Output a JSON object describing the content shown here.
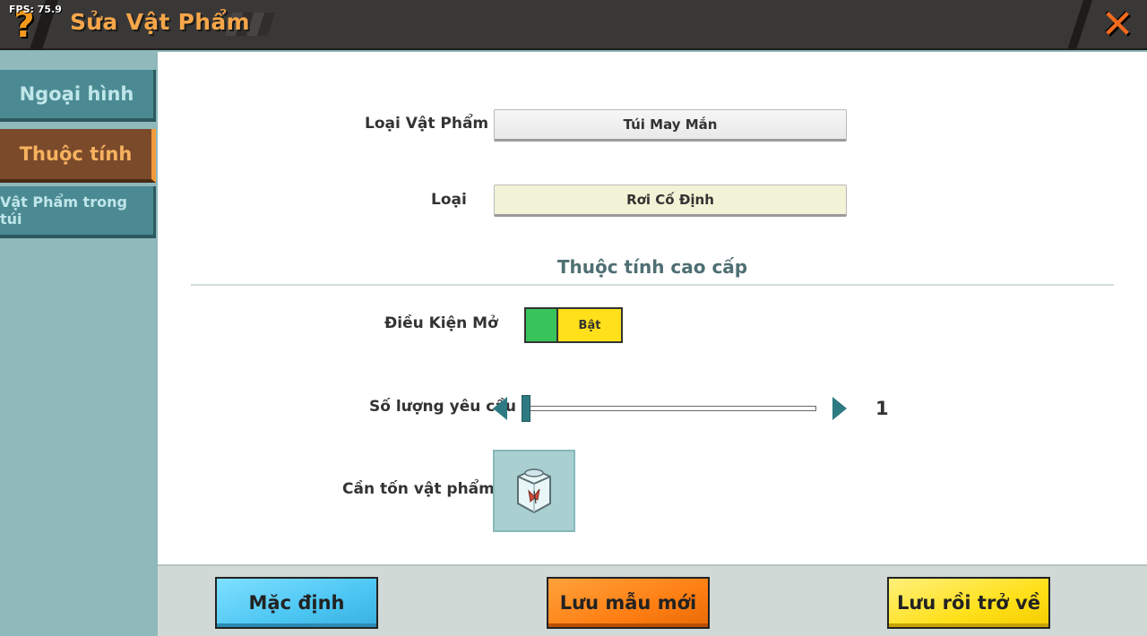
{
  "header": {
    "title": "Sửa Vật Phẩm",
    "fps": "FPS: 75.9",
    "help_icon": "question-mark-icon",
    "close_icon": "close-x-icon"
  },
  "sidebar": {
    "items": [
      {
        "label": "Ngoại hình",
        "active": false
      },
      {
        "label": "Thuộc tính",
        "active": true
      },
      {
        "label": "Vật Phẩm trong túi",
        "active": false
      }
    ]
  },
  "form": {
    "item_type_label": "Loại Vật Phẩm",
    "item_type_value": "Túi May Mắn",
    "type_label": "Loại",
    "type_value": "Rơi Cố Định",
    "section_title": "Thuộc tính cao cấp",
    "unlock_condition_label": "Điều Kiện Mở",
    "unlock_toggle_label": "Bật",
    "quantity_label": "Số lượng yêu cầu",
    "quantity_value": "1",
    "required_item_label": "Cần tốn vật phẩm",
    "required_item_icon": "glass-jar-butterfly-icon"
  },
  "footer": {
    "default_label": "Mặc định",
    "save_template_label": "Lưu mẫu mới",
    "save_return_label": "Lưu rồi trở về",
    "debug_left": "",
    "debug_right": ""
  },
  "colors": {
    "header_bg": "#3a3836",
    "title": "#f6a64a",
    "sidebar_bg": "#8fb9bb",
    "tab_active": "#7b4a2b",
    "tab_inactive": "#4b8a92",
    "toggle_on": "#38c45a",
    "toggle_button": "#ffe01a",
    "slider_accent": "#2d7a82",
    "btn_blue": "#4cc6f3",
    "btn_orange": "#ff7f14",
    "btn_yellow": "#ffe01a"
  }
}
